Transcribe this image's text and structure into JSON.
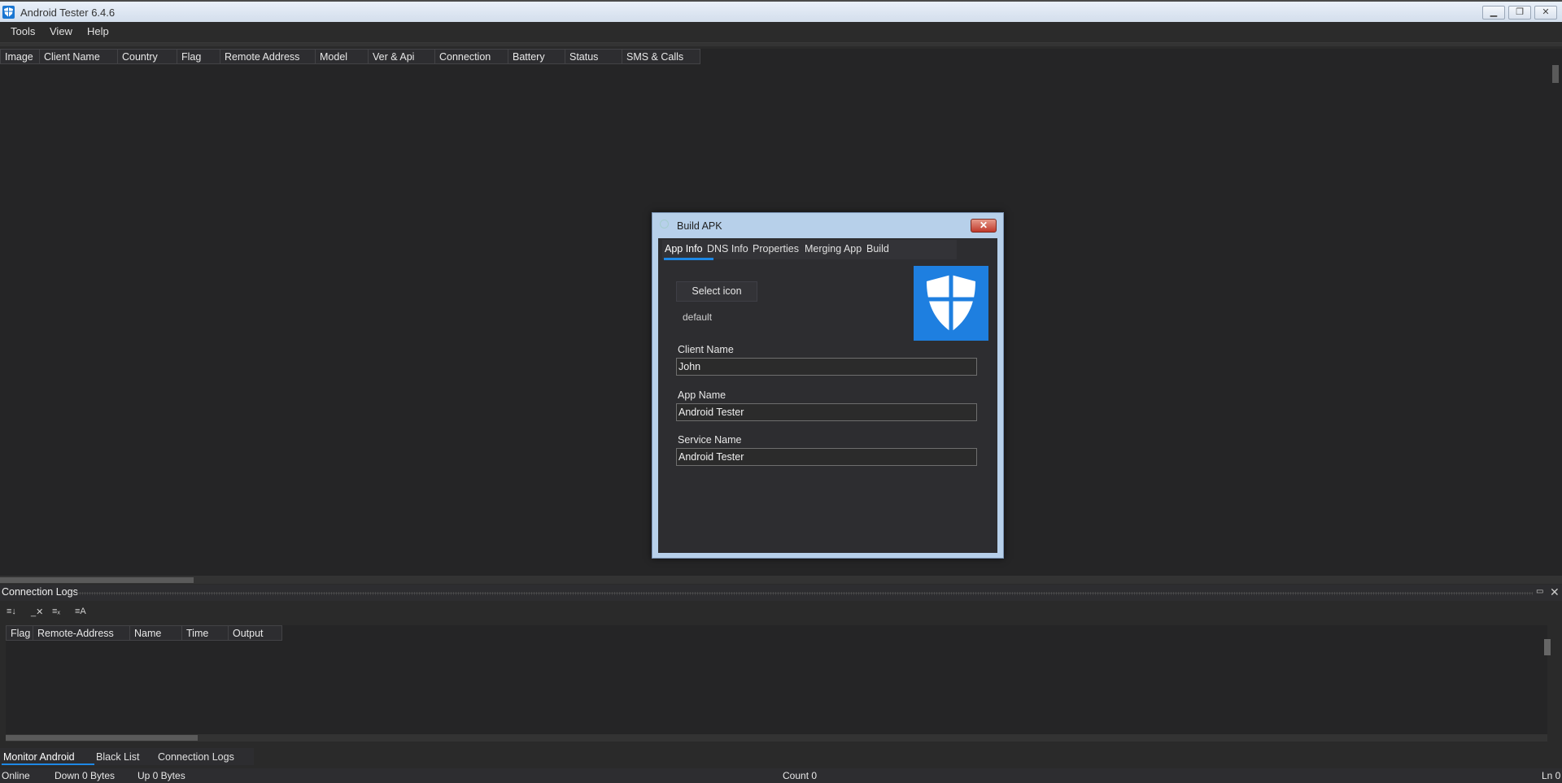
{
  "window": {
    "title": "Android Tester 6.4.6"
  },
  "menu": [
    "Tools",
    "View",
    "Help"
  ],
  "client_grid": {
    "columns": [
      "Image",
      "Client Name",
      "Country",
      "Flag",
      "Remote Address",
      "Model",
      "Ver & Api",
      "Connection",
      "Battery",
      "Status",
      "SMS & Calls"
    ]
  },
  "dialog": {
    "title": "Build APK",
    "close_label": "✕",
    "tabs": [
      "App Info",
      "DNS Info",
      "Properties",
      "Merging App",
      "Build"
    ],
    "active_tab": "App Info",
    "select_icon_label": "Select icon",
    "icon_name": "default",
    "icon_preview": "shield-icon",
    "fields": {
      "client_name": {
        "label": "Client Name",
        "value": "John"
      },
      "app_name": {
        "label": "App Name",
        "value": "Android Tester"
      },
      "service_name": {
        "label": "Service Name",
        "value": "Android Tester"
      }
    }
  },
  "logs": {
    "title": "Connection Logs",
    "columns": [
      "Flag",
      "Remote-Address",
      "Name",
      "Time",
      "Output"
    ]
  },
  "bottom_tabs": [
    "Monitor Android",
    "Black List",
    "Connection Logs"
  ],
  "status": {
    "online": "Online",
    "down": "Down 0 Bytes",
    "up": "Up 0 Bytes",
    "count": "Count 0",
    "line": "Ln 0"
  },
  "colors": {
    "accent": "#1e88e5",
    "icon_bg": "#1e7fe0",
    "close_red": "#c0392b"
  }
}
